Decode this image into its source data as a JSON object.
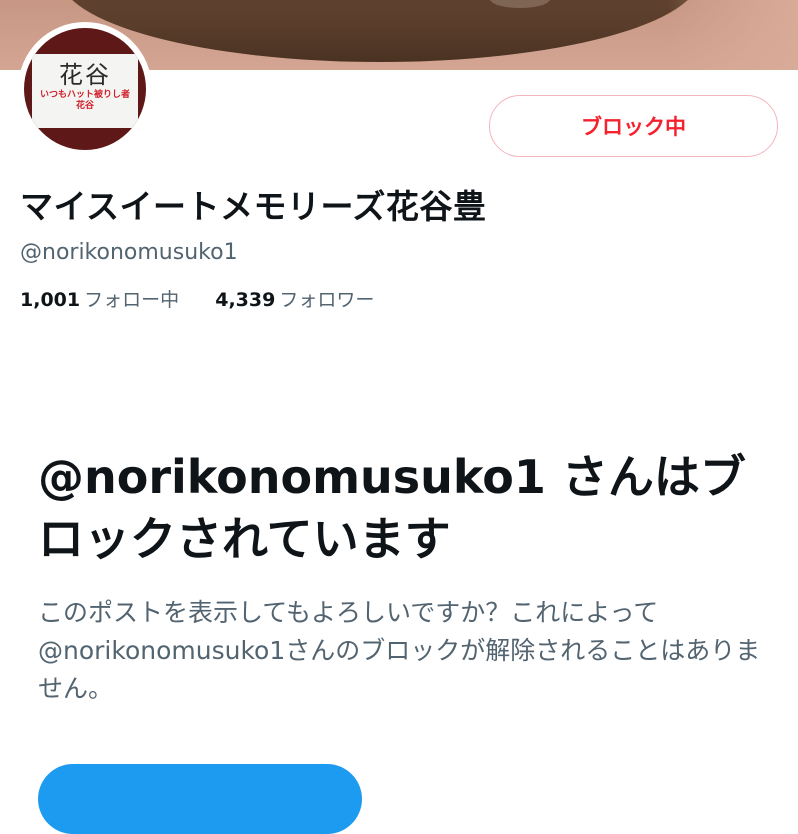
{
  "profile": {
    "avatar": {
      "name": "花谷",
      "tagline_line1": "いつもハット被りし者",
      "tagline_line2": "花谷"
    },
    "block_button_label": "ブロック中",
    "display_name": "マイスイートメモリーズ花谷豊",
    "handle": "@norikonomusuko1",
    "following_count": "1,001",
    "following_label": "フォロー中",
    "followers_count": "4,339",
    "followers_label": "フォロワー"
  },
  "blocked_notice": {
    "title": "@norikonomusuko1 さんはブロックされています",
    "description": "このポストを表示してもよろしいですか？これによって@norikonomusuko1さんのブロックが解除されることはありません。"
  },
  "colors": {
    "accent_blue": "#1d9bf0",
    "block_red": "#f4212e",
    "secondary_text": "#536471"
  }
}
